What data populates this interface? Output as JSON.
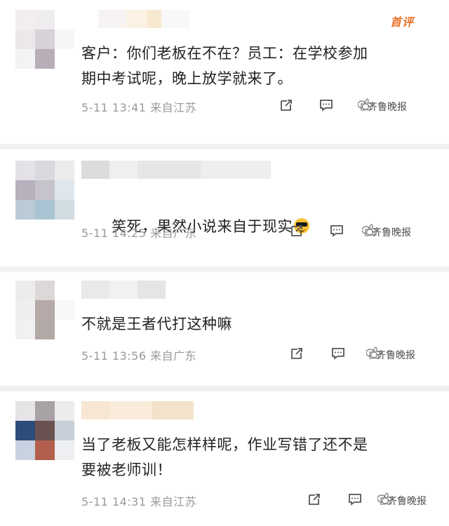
{
  "hot_label": "首评",
  "comments": [
    {
      "text": "客户：你们老板在不在？员工：在学校参加\n期中考试呢，晚上放学就来了。",
      "timestamp": "5-11 13:41",
      "location": "来自江苏",
      "watermark": "齐鲁晚报"
    },
    {
      "text": "笑死，果然小说来自于现实",
      "timestamp": "5-11 14:25",
      "location": "来自广东",
      "watermark": "齐鲁晚报"
    },
    {
      "text": "不就是王者代打这种嘛",
      "timestamp": "5-11 13:56",
      "location": "来自广东",
      "watermark": "齐鲁晚报"
    },
    {
      "text": "当了老板又能怎样样呢，作业写错了还不是\n要被老师训！",
      "timestamp": "5-11 14:31",
      "location": "来自江苏",
      "watermark": "齐鲁晚报"
    }
  ],
  "colors": {
    "accent": "#e8722a",
    "meta_text": "#9a9a9a",
    "separator": "#f1f1f1"
  },
  "icons": [
    "share-icon",
    "comment-icon",
    "like-icon",
    "wechat-icon",
    "sunglasses-emoji"
  ]
}
